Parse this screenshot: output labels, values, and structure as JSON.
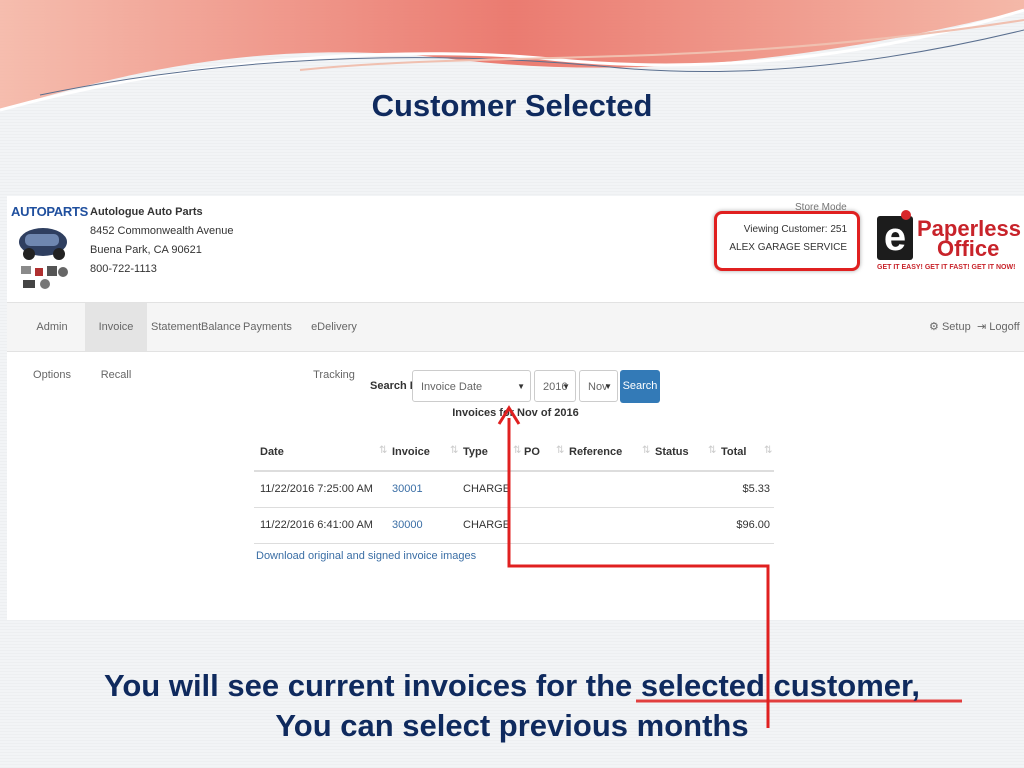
{
  "slide": {
    "title": "Customer Selected",
    "caption_line1": "You will see current invoices for the selected customer,",
    "caption_line2": "You can select previous months"
  },
  "header": {
    "logo_text": "AUTOPARTS",
    "company_name": "Autologue Auto Parts",
    "address1": "8452 Commonwealth Avenue",
    "address2": "Buena Park, CA 90621",
    "phone": "800-722-1113",
    "store_mode": "Store Mode",
    "viewing_customer": "Viewing Customer: 251",
    "customer_name": "ALEX GARAGE SERVICE",
    "brand_e": "e",
    "brand_paperless": "Paperless",
    "brand_office": "Office",
    "brand_tagline": "GET IT EASY! GET IT FAST! GET IT NOW!"
  },
  "nav": {
    "items": [
      {
        "label": "Admin Options"
      },
      {
        "label": "Invoice Recall",
        "active": true
      },
      {
        "label": "Statement"
      },
      {
        "label": "Balance"
      },
      {
        "label": "Payments"
      },
      {
        "label": "eDelivery Tracking"
      }
    ],
    "setup": "Setup",
    "logoff": "Logoff"
  },
  "search": {
    "label": "Search By:",
    "by_value": "Invoice Date",
    "year_value": "2016",
    "month_value": "Nov",
    "button": "Search",
    "results_heading": "Invoices for Nov of 2016"
  },
  "table": {
    "columns": [
      "Date",
      "Invoice",
      "Type",
      "PO",
      "Reference",
      "Status",
      "Total"
    ],
    "rows": [
      {
        "date": "11/22/2016 7:25:00 AM",
        "invoice": "30001",
        "type": "CHARGE",
        "po": "",
        "reference": "",
        "status": "",
        "total": "$5.33"
      },
      {
        "date": "11/22/2016 6:41:00 AM",
        "invoice": "30000",
        "type": "CHARGE",
        "po": "",
        "reference": "",
        "status": "",
        "total": "$96.00"
      }
    ],
    "download_link": "Download original and signed invoice images"
  },
  "colors": {
    "title": "#0f2a5e",
    "accent_red": "#e02020",
    "button_blue": "#337ab7",
    "link_blue": "#3a6ea5"
  }
}
